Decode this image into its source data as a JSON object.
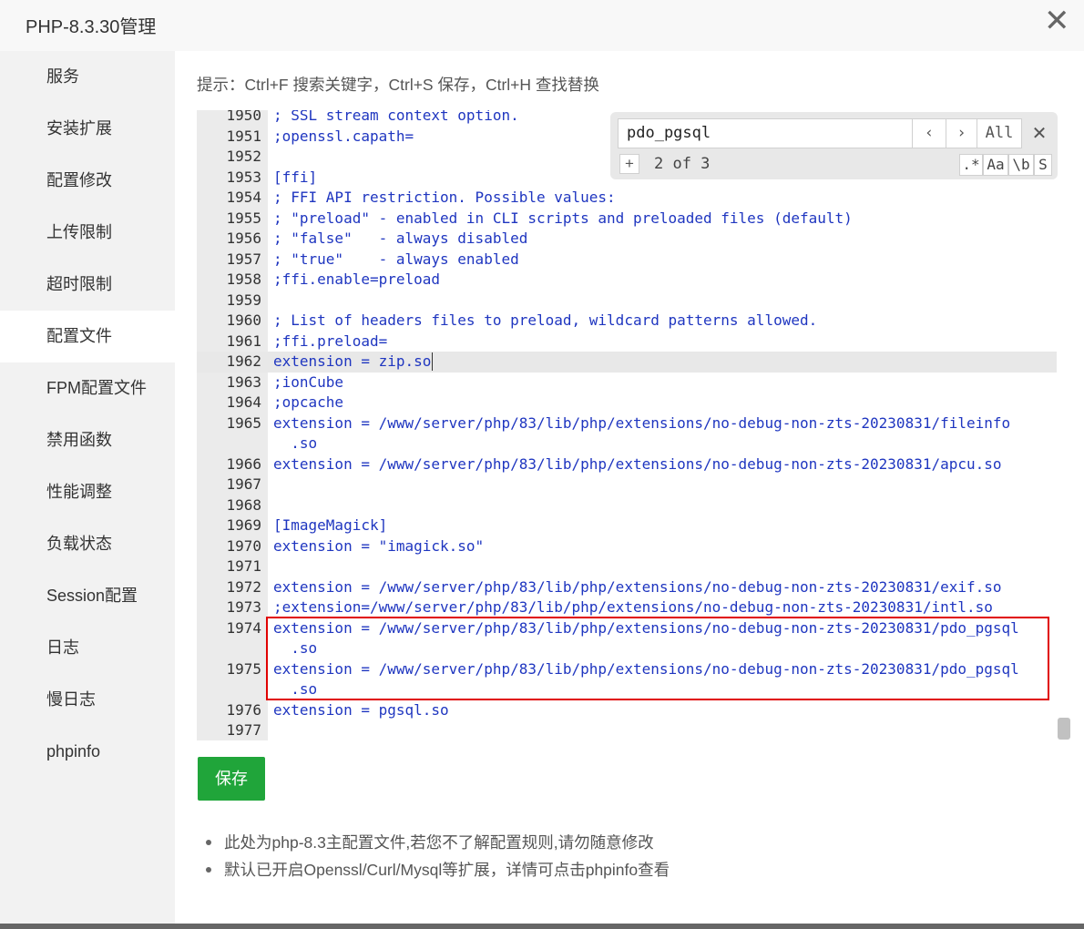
{
  "window": {
    "title": "PHP-8.3.30管理",
    "close_label": "✕"
  },
  "sidebar": {
    "items": [
      {
        "label": "服务"
      },
      {
        "label": "安装扩展"
      },
      {
        "label": "配置修改"
      },
      {
        "label": "上传限制"
      },
      {
        "label": "超时限制"
      },
      {
        "label": "配置文件",
        "active": true
      },
      {
        "label": "FPM配置文件"
      },
      {
        "label": "禁用函数"
      },
      {
        "label": "性能调整"
      },
      {
        "label": "负载状态"
      },
      {
        "label": "Session配置"
      },
      {
        "label": "日志"
      },
      {
        "label": "慢日志"
      },
      {
        "label": "phpinfo"
      }
    ]
  },
  "tip": "提示：Ctrl+F 搜索关键字，Ctrl+S 保存，Ctrl+H 查找替换",
  "search": {
    "value": "pdo_pgsql",
    "prev_icon": "‹",
    "next_icon": "›",
    "all_label": "All",
    "close_icon": "✕",
    "expand_icon": "+",
    "count": "2 of 3",
    "regex_label": ".*",
    "case_label": "Aa",
    "word_label": "\\b",
    "selection_label": "S"
  },
  "editor": {
    "lines": [
      {
        "n": "1950",
        "t": "; SSL stream context option."
      },
      {
        "n": "1951",
        "t": ";openssl.capath="
      },
      {
        "n": "1952",
        "t": ""
      },
      {
        "n": "1953",
        "t": "[ffi]"
      },
      {
        "n": "1954",
        "t": "; FFI API restriction. Possible values:"
      },
      {
        "n": "1955",
        "t": "; \"preload\" - enabled in CLI scripts and preloaded files (default)"
      },
      {
        "n": "1956",
        "t": "; \"false\"   - always disabled"
      },
      {
        "n": "1957",
        "t": "; \"true\"    - always enabled"
      },
      {
        "n": "1958",
        "t": ";ffi.enable=preload"
      },
      {
        "n": "1959",
        "t": ""
      },
      {
        "n": "1960",
        "t": "; List of headers files to preload, wildcard patterns allowed."
      },
      {
        "n": "1961",
        "t": ";ffi.preload="
      },
      {
        "n": "1962",
        "t": "extension = zip.so",
        "current": true
      },
      {
        "n": "1963",
        "t": ";ionCube"
      },
      {
        "n": "1964",
        "t": ";opcache"
      },
      {
        "n": "1965",
        "t": "extension = /www/server/php/83/lib/php/extensions/no-debug-non-zts-20230831/fileinfo"
      },
      {
        "n": "",
        "t": "  .so"
      },
      {
        "n": "1966",
        "t": "extension = /www/server/php/83/lib/php/extensions/no-debug-non-zts-20230831/apcu.so"
      },
      {
        "n": "1967",
        "t": ""
      },
      {
        "n": "1968",
        "t": ""
      },
      {
        "n": "1969",
        "t": "[ImageMagick]"
      },
      {
        "n": "1970",
        "t": "extension = \"imagick.so\""
      },
      {
        "n": "1971",
        "t": ""
      },
      {
        "n": "1972",
        "t": "extension = /www/server/php/83/lib/php/extensions/no-debug-non-zts-20230831/exif.so"
      },
      {
        "n": "1973",
        "t": ";extension=/www/server/php/83/lib/php/extensions/no-debug-non-zts-20230831/intl.so"
      },
      {
        "n": "1974",
        "t": "extension = /www/server/php/83/lib/php/extensions/no-debug-non-zts-20230831/pdo_pgsql"
      },
      {
        "n": "",
        "t": "  .so"
      },
      {
        "n": "1975",
        "t": "extension = /www/server/php/83/lib/php/extensions/no-debug-non-zts-20230831/pdo_pgsql"
      },
      {
        "n": "",
        "t": "  .so"
      },
      {
        "n": "1976",
        "t": "extension = pgsql.so"
      },
      {
        "n": "1977",
        "t": ""
      }
    ]
  },
  "save_label": "保存",
  "notes": [
    "此处为php-8.3主配置文件,若您不了解配置规则,请勿随意修改",
    "默认已开启Openssl/Curl/Mysql等扩展，详情可点击phpinfo查看"
  ]
}
